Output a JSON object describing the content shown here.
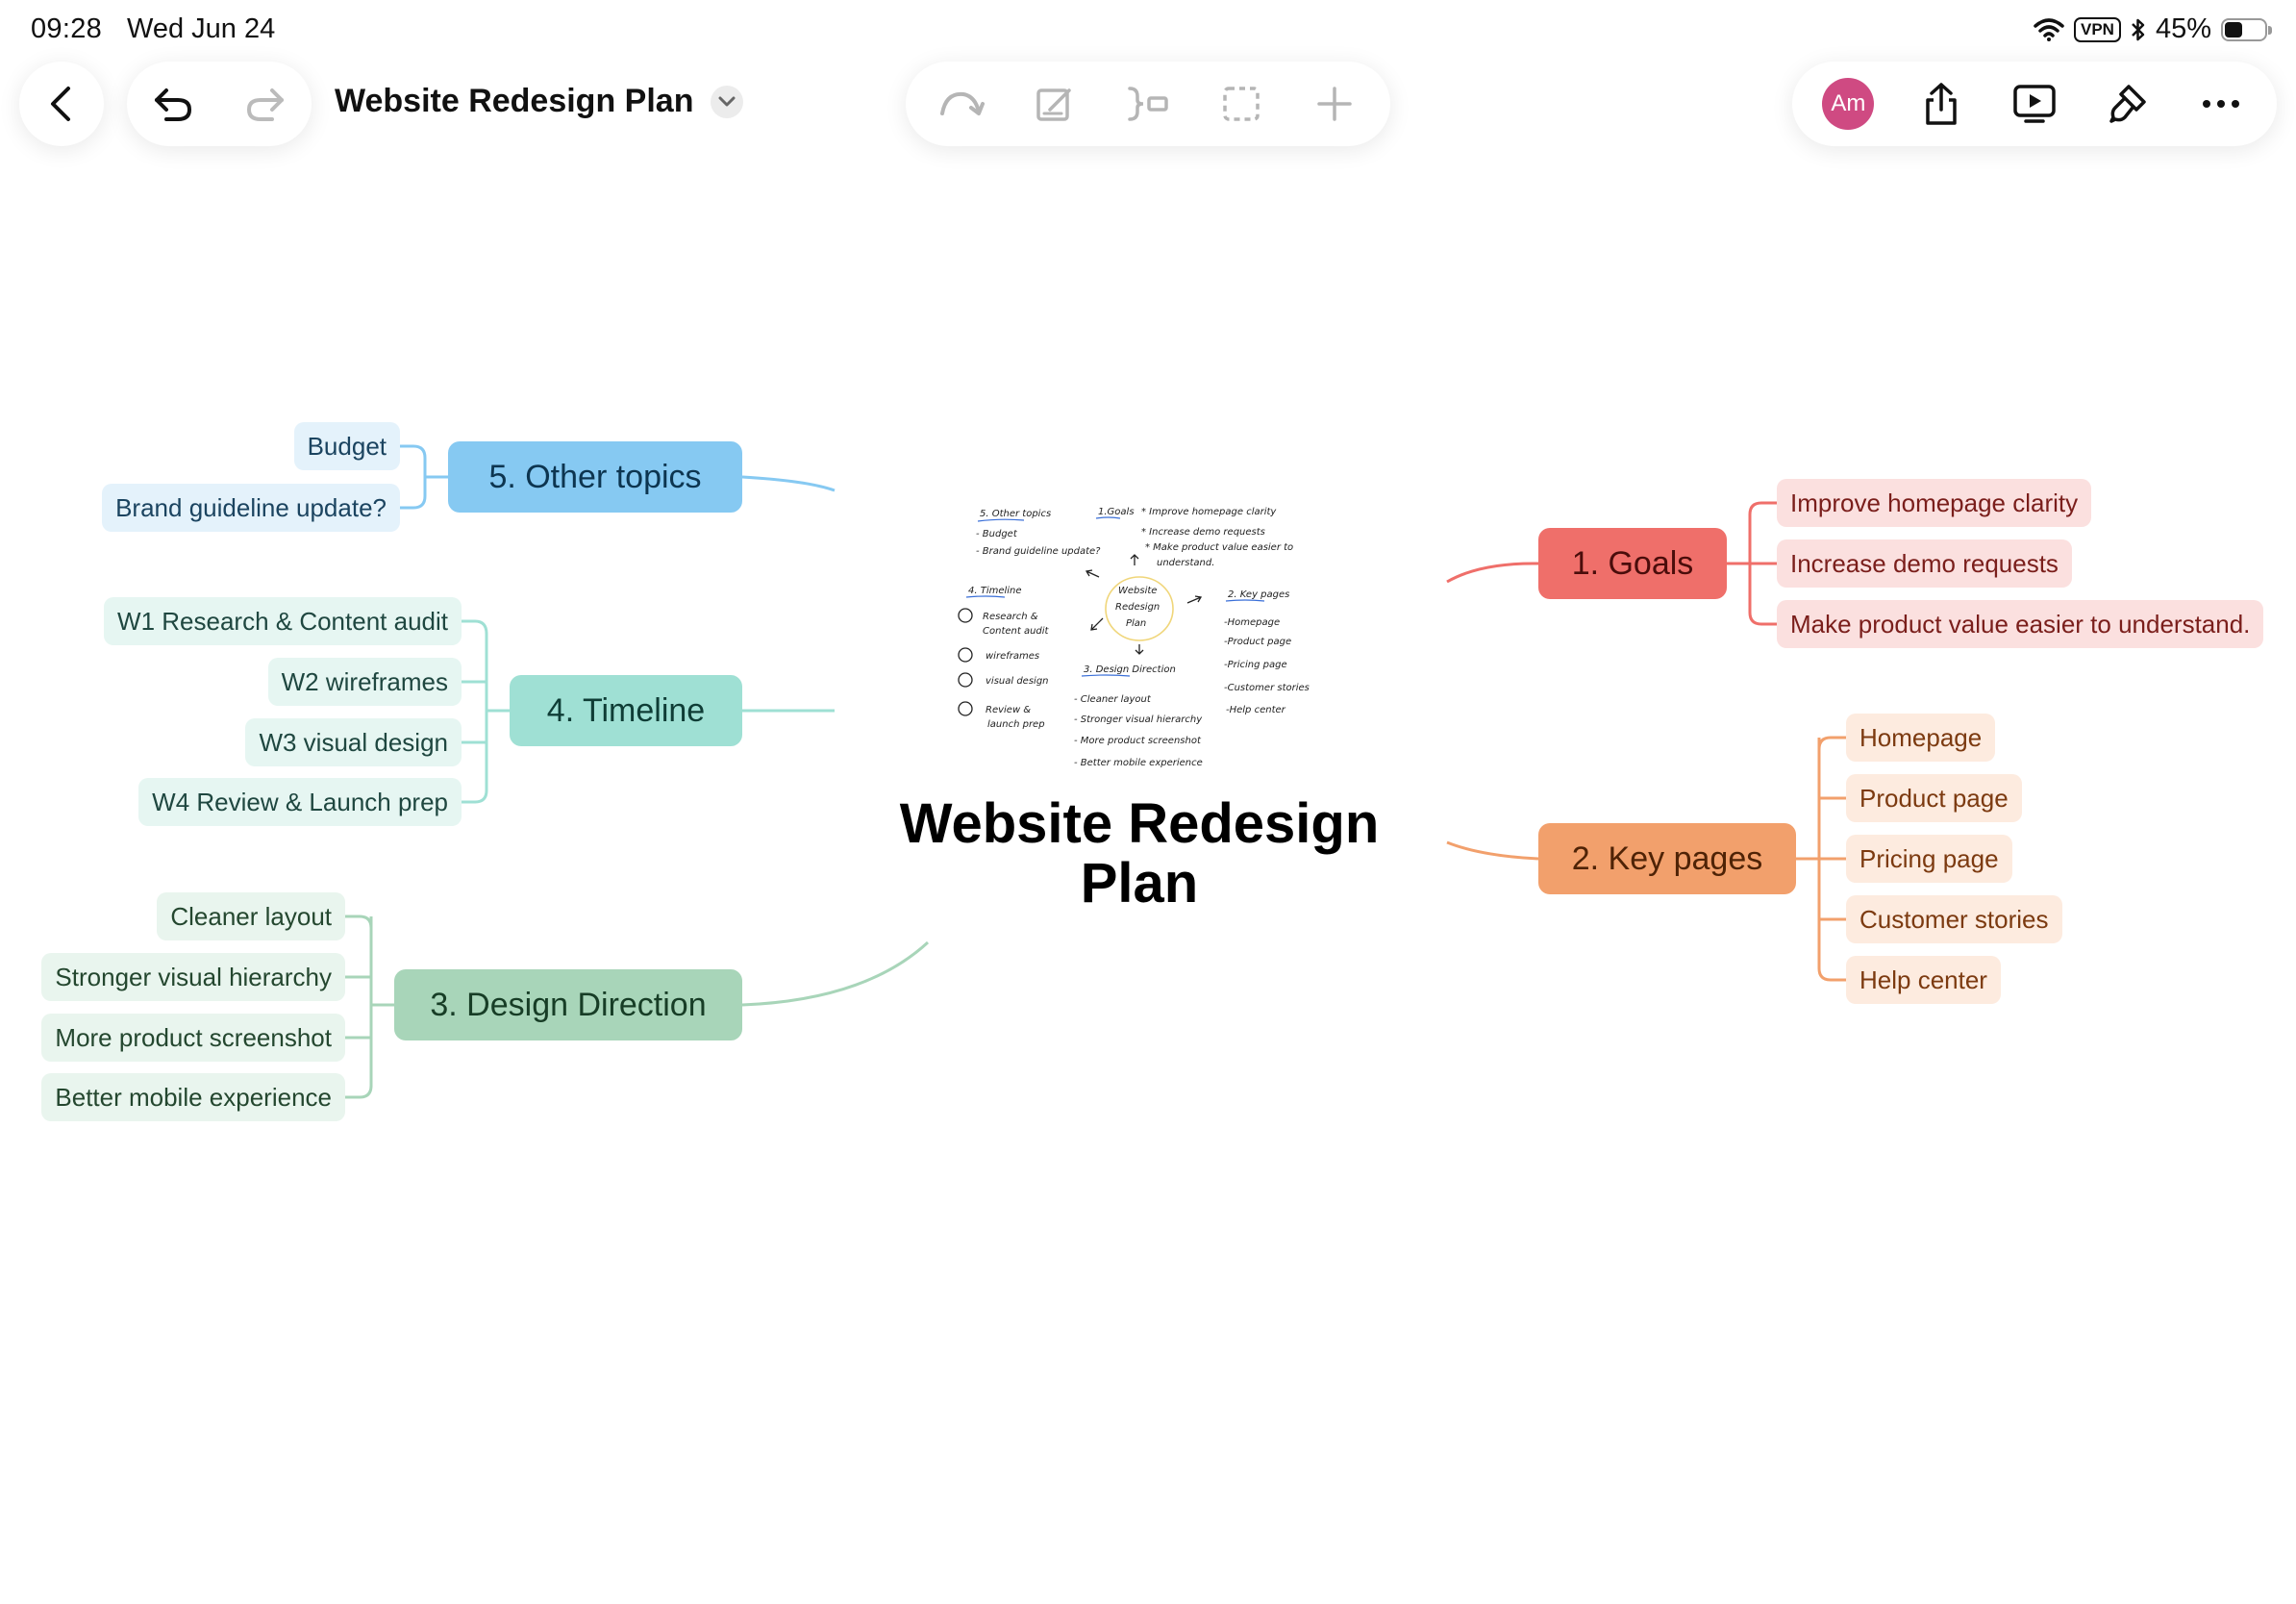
{
  "status_bar": {
    "time": "09:28",
    "date": "Wed Jun 24",
    "vpn": "VPN",
    "battery": "45%",
    "battery_level": 0.45
  },
  "toolbar": {
    "title": "Website Redesign Plan",
    "avatar_initials": "Am",
    "avatar_color": "#cf4a82"
  },
  "mindmap": {
    "center": {
      "title": "Website Redesign Plan"
    },
    "branches": [
      {
        "label": "1. Goals",
        "color": "#ef6f6a",
        "items": [
          "Improve homepage clarity",
          "Increase demo requests",
          "Make product value easier to understand."
        ]
      },
      {
        "label": "2. Key pages",
        "color": "#f2a06c",
        "items": [
          "Homepage",
          "Product page",
          "Pricing page",
          "Customer stories",
          "Help center"
        ]
      },
      {
        "label": "3. Design Direction",
        "color": "#a8d5b9",
        "items": [
          "Cleaner layout",
          "Stronger visual hierarchy",
          "More product screenshot",
          "Better mobile experience"
        ]
      },
      {
        "label": "4. Timeline",
        "color": "#9fe0d4",
        "items": [
          "W1 Research & Content audit",
          "W2 wireframes",
          "W3 visual design",
          "W4 Review & Launch prep"
        ]
      },
      {
        "label": "5. Other topics",
        "color": "#86c9f2",
        "items": [
          "Budget",
          "Brand guideline update?"
        ]
      }
    ]
  },
  "sketch": {
    "other_topics": "5. Other topics",
    "budget": "- Budget",
    "brand": "- Brand guideline update?",
    "goals": "1.Goals",
    "goal1": "* Improve homepage clarity",
    "goal2": "* Increase demo requests",
    "goal3": "* Make product value easier to",
    "goal3b": "understand.",
    "center1": "Website",
    "center2": "Redesign",
    "center3": "Plan",
    "timeline": "4. Timeline",
    "w1a": "Research &",
    "w1b": "Content audit",
    "w2": "wireframes",
    "w3": "visual design",
    "w4a": "Review &",
    "w4b": "launch prep",
    "keypages": "2. Key pages",
    "k1": "-Homepage",
    "k2": "-Product page",
    "k3": "-Pricing page",
    "k4": "-Customer stories",
    "k5": "-Help center",
    "design": "3. Design Direction",
    "d1": "- Cleaner layout",
    "d2": "- Stronger visual hierarchy",
    "d3": "- More product screenshot",
    "d4": "- Better mobile experience"
  }
}
